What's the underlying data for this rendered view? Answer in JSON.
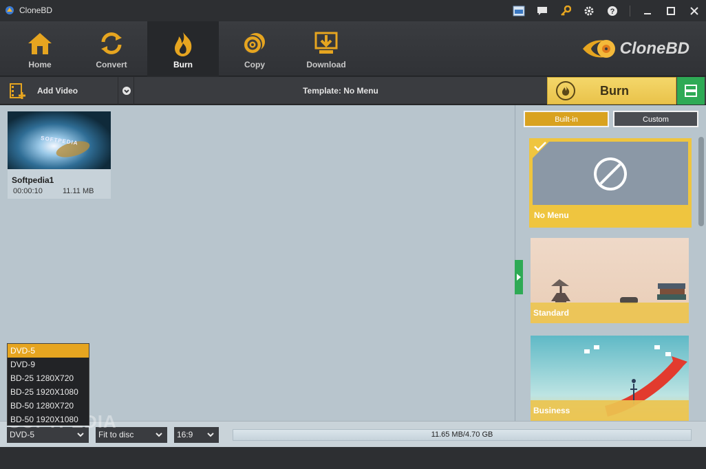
{
  "window": {
    "title": "CloneBD"
  },
  "nav": {
    "items": [
      {
        "label": "Home",
        "icon": "home-icon"
      },
      {
        "label": "Convert",
        "icon": "convert-icon"
      },
      {
        "label": "Burn",
        "icon": "burn-icon",
        "active": true
      },
      {
        "label": "Copy",
        "icon": "copy-icon"
      },
      {
        "label": "Download",
        "icon": "download-icon"
      }
    ]
  },
  "brand": {
    "name": "CloneBD"
  },
  "subbar": {
    "add_video": "Add Video",
    "template": "Template: No Menu",
    "burn": "Burn"
  },
  "video": {
    "name": "Softpedia1",
    "duration": "00:00:10",
    "size": "11.11 MB",
    "thumb_text": "SOFTPEDIA"
  },
  "disc_options": [
    "DVD-5",
    "DVD-9",
    "BD-25 1280X720",
    "BD-25 1920X1080",
    "BD-50 1280X720",
    "BD-50 1920X1080"
  ],
  "templates": {
    "tabs": {
      "builtin": "Built-in",
      "custom": "Custom"
    },
    "items": [
      {
        "label": "No Menu",
        "selected": true
      },
      {
        "label": "Standard"
      },
      {
        "label": "Business"
      }
    ]
  },
  "bottom": {
    "disc": "DVD-5",
    "fit": "Fit to disc",
    "aspect": "16:9",
    "usage": "11.65 MB/4.70 GB"
  },
  "watermark": "SOFTPEDIA",
  "colors": {
    "accent": "#e6a520",
    "green": "#2eaa55",
    "panel": "#b8c5cd"
  }
}
